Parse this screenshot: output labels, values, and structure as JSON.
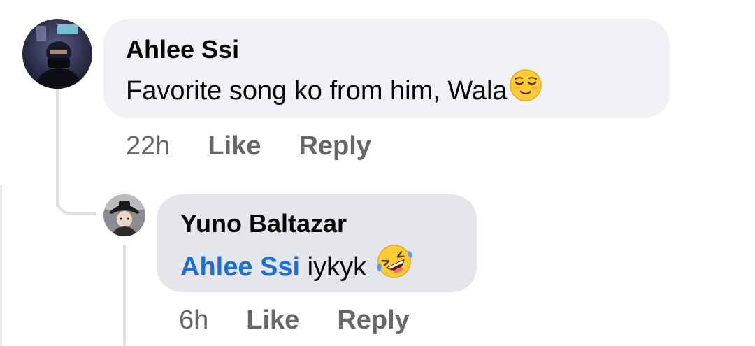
{
  "comments": [
    {
      "author": "Ahlee Ssi",
      "text": "Favorite song ko from him, Wala",
      "emoji": "relieved-face-icon",
      "time": "22h",
      "like_label": "Like",
      "reply_label": "Reply"
    }
  ],
  "replies": [
    {
      "author": "Yuno Baltazar",
      "mention": "Ahlee Ssi",
      "text": " iykyk ",
      "emoji": "rolling-on-floor-laughing-icon",
      "time": "6h",
      "like_label": "Like",
      "reply_label": "Reply"
    }
  ],
  "colors": {
    "bubble_main": "#f0f2f5",
    "bubble_reply": "#e4e6eb",
    "mention": "#1d6fd6",
    "meta": "#65676b",
    "thread_line": "#dfe1e5"
  }
}
